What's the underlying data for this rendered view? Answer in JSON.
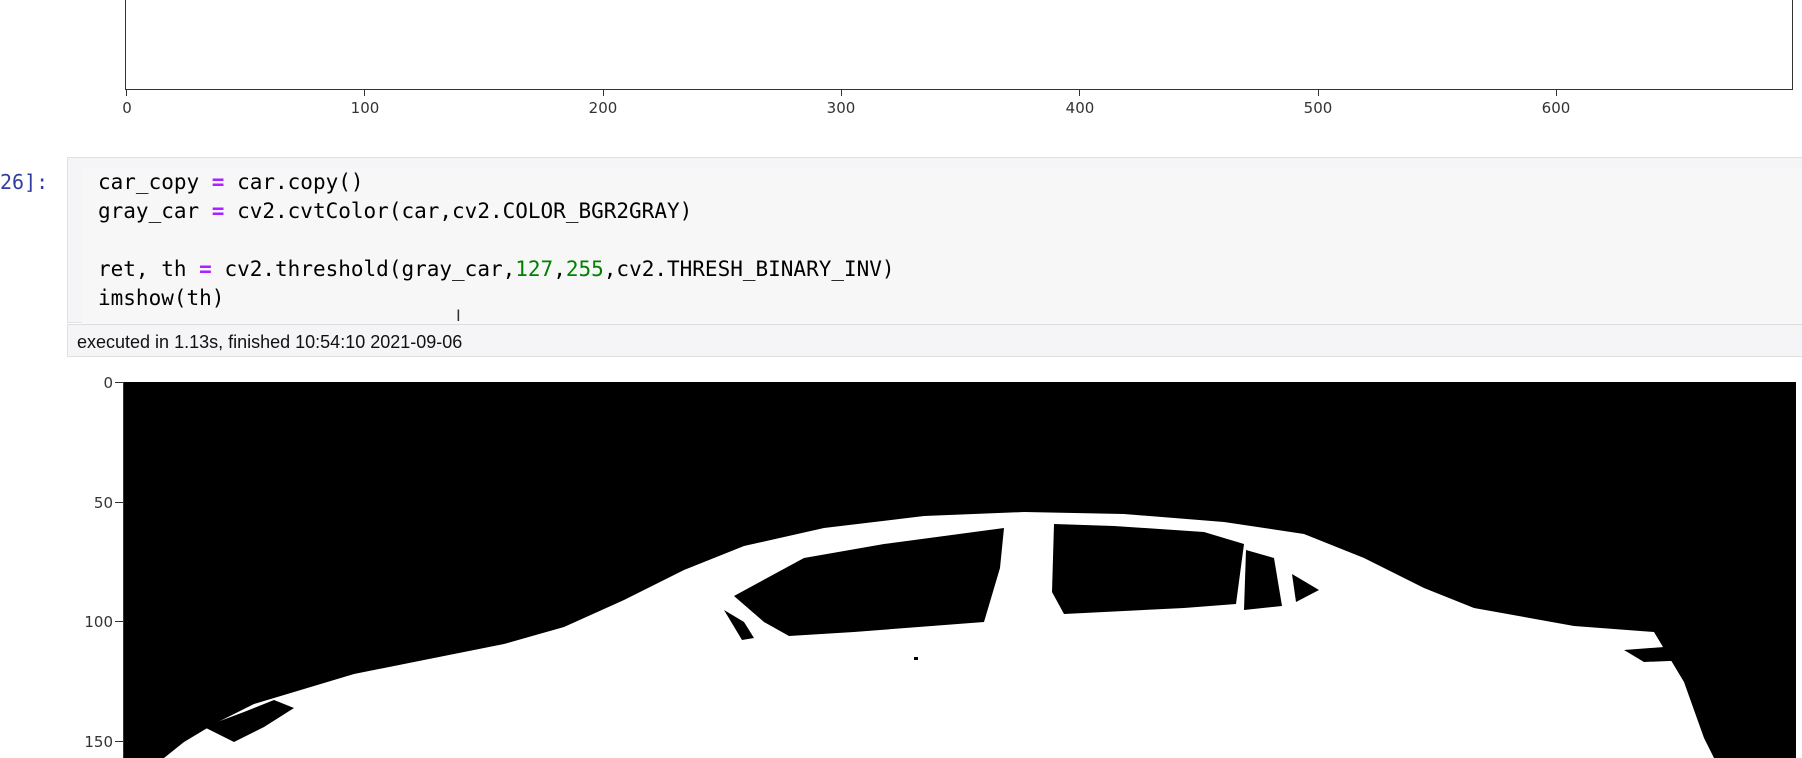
{
  "top_plot": {
    "x_ticks": [
      "0",
      "100",
      "200",
      "300",
      "400",
      "500",
      "600"
    ]
  },
  "cell": {
    "prompt": "26]:",
    "code_lines": [
      "car_copy = car.copy()",
      "gray_car = cv2.cvtColor(car,cv2.COLOR_BGR2GRAY)",
      "",
      "ret, th = cv2.threshold(gray_car,127,255,cv2.THRESH_BINARY_INV)",
      "imshow(th)"
    ],
    "execution_info": "executed in 1.13s, finished 10:54:10 2021-09-06"
  },
  "output_image": {
    "y_ticks": [
      "0",
      "50",
      "100",
      "150"
    ],
    "description_colors": {
      "background": "#000000",
      "foreground": "#ffffff"
    }
  },
  "colors": {
    "prompt": "#303f9f",
    "operator": "#aa22ff",
    "number": "#008000",
    "cell_bg": "#f5f5f7"
  }
}
